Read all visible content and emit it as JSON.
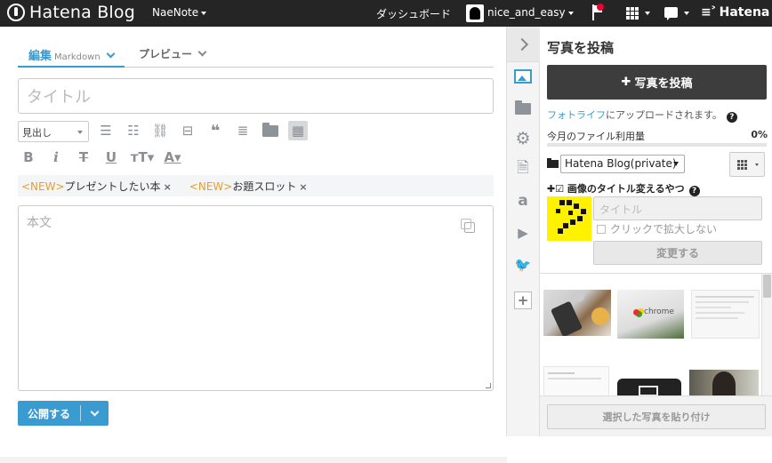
{
  "topbar": {
    "brand": "Hatena Blog",
    "blog_name": "NaeNote",
    "dashboard": "ダッシュボード",
    "username": "nice_and_easy",
    "service": "Hatena"
  },
  "editor": {
    "tabs": [
      {
        "label": "編集",
        "sub": "Markdown"
      },
      {
        "label": "プレビュー"
      }
    ],
    "title_placeholder": "タイトル",
    "format_select": "見出し",
    "tags": [
      {
        "new": "<NEW>",
        "label": "プレゼントしたい本",
        "remove": "×"
      },
      {
        "new": "<NEW>",
        "label": "お題スロット",
        "remove": "×"
      }
    ],
    "body_placeholder": "本文",
    "publish_label": "公開する"
  },
  "toolbar_icons": [
    "bullet-list-icon",
    "numbered-list-icon",
    "link-icon",
    "horizontal-rule-icon",
    "quote-icon",
    "more-icon",
    "folder-icon",
    "table-icon",
    "bold-icon",
    "italic-icon",
    "strikethrough-icon",
    "underline-icon",
    "font-size-icon",
    "font-color-icon"
  ],
  "photo_panel": {
    "title": "写真を投稿",
    "upload_button": "写真を投稿",
    "fotolife_link": "フォトライフ",
    "fotolife_text": "にアップロードされます。",
    "usage_label": "今月のファイル利用量",
    "usage_value": "0%",
    "usage_fraction": 0,
    "album": "Hatena Blog(private)",
    "plugin_label": "画像のタイトル変えるやつ",
    "title_input_placeholder": "タイトル",
    "no_zoom_label": "クリックで拡大しない",
    "change_button": "変更する",
    "paste_button": "選択した写真を貼り付け"
  },
  "colors": {
    "accent": "#3a9bd0",
    "topbar_bg": "#252525",
    "tag_new": "#e59f2b",
    "thumb_yellow": "#fff200"
  }
}
